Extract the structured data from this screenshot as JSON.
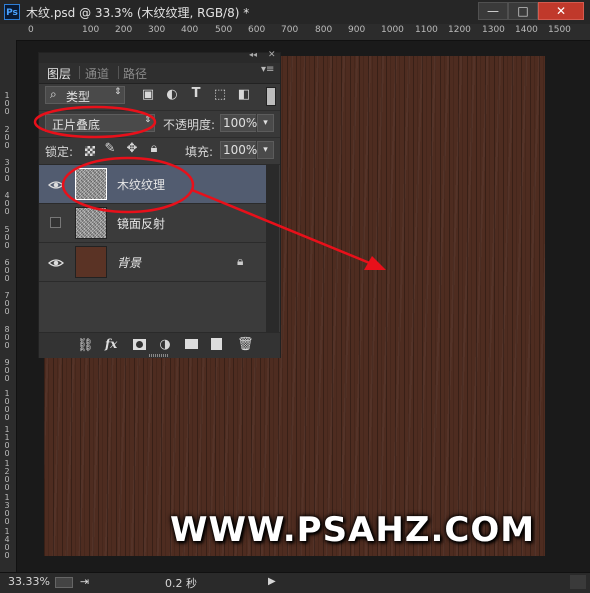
{
  "window": {
    "app_icon": "Ps",
    "title": "木纹.psd @ 33.3% (木纹纹理, RGB/8) *",
    "minimize_glyph": "—",
    "maximize_glyph": "□",
    "close_glyph": "✕"
  },
  "ruler": {
    "horizontal_labels": [
      "0",
      "100",
      "200",
      "300",
      "400",
      "500",
      "600",
      "700",
      "800",
      "900",
      "1000",
      "1100",
      "1200",
      "1300",
      "1400",
      "1500"
    ],
    "vertical_labels": [
      "1 0 0",
      "2 0 0",
      "3 0 0",
      "4 0 0",
      "5 0 0",
      "6 0 0",
      "7 0 0",
      "8 0 0",
      "9 0 0",
      "1 0 0 0",
      "1 1 0 0",
      "1 2 0 0",
      "1 3 0 0",
      "1 4 0 0",
      "1 5 0 0"
    ]
  },
  "layers_panel": {
    "collapse_glyph": "◂◂",
    "close_glyph": "✕",
    "menu_glyph": "▾≡",
    "tabs": [
      "图层",
      "通道",
      "路径"
    ],
    "filter": {
      "search_glyph": "⌕",
      "value": "类型"
    },
    "blend_mode": "正片叠底",
    "opacity_label": "不透明度:",
    "opacity_value": "100%",
    "lock_label": "锁定:",
    "fill_label": "填充:",
    "fill_value": "100%",
    "layers": [
      {
        "name": "木纹纹理",
        "visible": true,
        "selected": true
      },
      {
        "name": "镜面反射",
        "visible": false,
        "selected": false
      },
      {
        "name": "背景",
        "visible": true,
        "locked": true,
        "selected": false
      }
    ],
    "bottom_icons": [
      "link-layers-icon",
      "fx-icon",
      "add-mask-icon",
      "adjustment-layer-icon",
      "new-group-icon",
      "new-layer-icon",
      "delete-layer-icon"
    ],
    "fx_label": "fx"
  },
  "colors": {
    "canvas_wood": "#4e2c20",
    "background_layer_thumb": "#5a3325",
    "selected_layer": "#505a6e",
    "annotation_red": "#e8101a"
  },
  "watermark": "WWW.PSAHZ.COM",
  "statusbar": {
    "zoom": "33.33%",
    "timing": "0.2 秒",
    "play_glyph": "▶"
  }
}
